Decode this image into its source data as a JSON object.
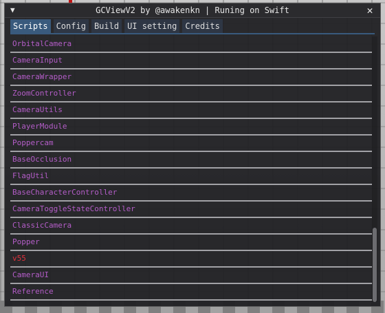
{
  "window": {
    "title": "GCViewV2 by @awakenkn | Runing on Swift"
  },
  "icons": {
    "collapse": "▼",
    "close": "✕"
  },
  "tabs": [
    {
      "label": "Scripts",
      "active": true
    },
    {
      "label": "Config",
      "active": false
    },
    {
      "label": "Build",
      "active": false
    },
    {
      "label": "UI setting",
      "active": false
    },
    {
      "label": "Credits",
      "active": false
    }
  ],
  "scripts": {
    "items": [
      {
        "label": "OrbitalCamera",
        "color": "#b45dc8"
      },
      {
        "label": "CameraInput",
        "color": "#b45dc8"
      },
      {
        "label": "CameraWrapper",
        "color": "#b45dc8"
      },
      {
        "label": "ZoomController",
        "color": "#b45dc8"
      },
      {
        "label": "CameraUtils",
        "color": "#b45dc8"
      },
      {
        "label": "PlayerModule",
        "color": "#b45dc8"
      },
      {
        "label": "Poppercam",
        "color": "#b45dc8"
      },
      {
        "label": "BaseOcclusion",
        "color": "#b45dc8"
      },
      {
        "label": "FlagUtil",
        "color": "#b45dc8"
      },
      {
        "label": "BaseCharacterController",
        "color": "#b45dc8"
      },
      {
        "label": "CameraToggleStateController",
        "color": "#b45dc8"
      },
      {
        "label": "ClassicCamera",
        "color": "#b45dc8"
      },
      {
        "label": "Popper",
        "color": "#b45dc8"
      },
      {
        "label": "v55",
        "color": "#e0323c"
      },
      {
        "label": "CameraUI",
        "color": "#b45dc8"
      },
      {
        "label": "Reference",
        "color": "#b45dc8"
      }
    ],
    "scroll_position_fraction": 0.72,
    "scroll_visible_fraction": 0.28
  }
}
